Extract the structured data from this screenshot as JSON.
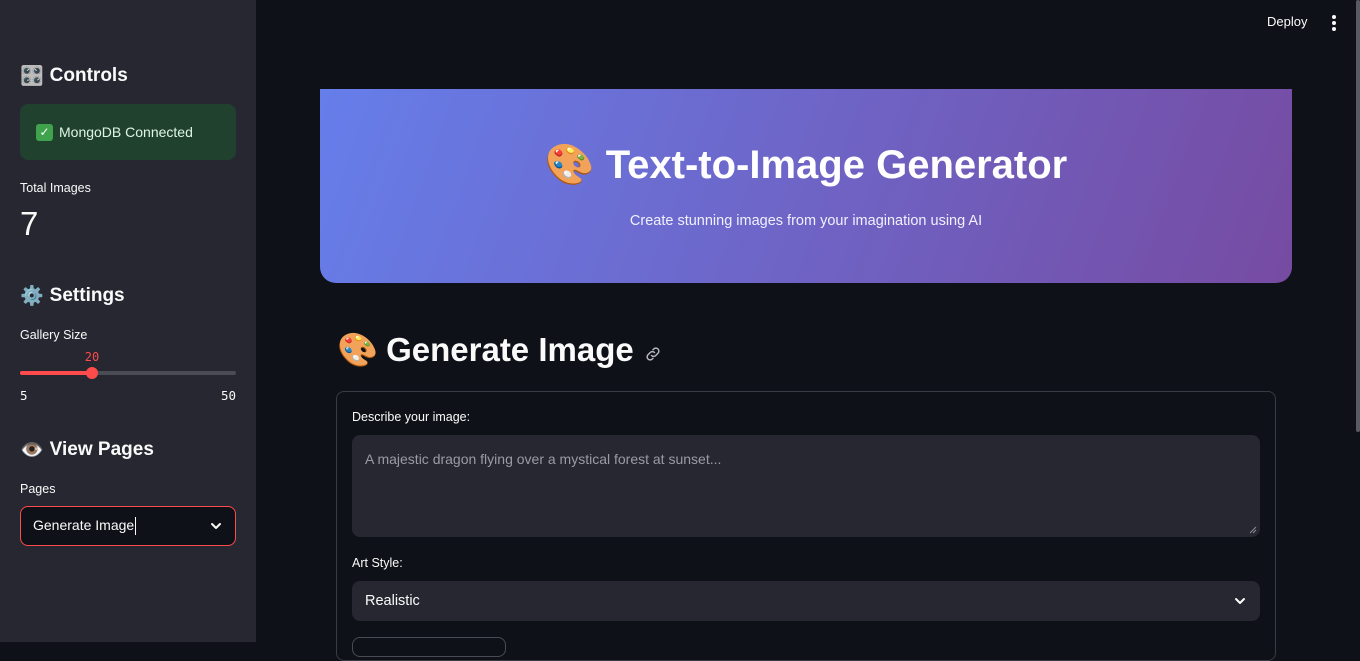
{
  "header": {
    "deploy_label": "Deploy"
  },
  "sidebar": {
    "controls_heading": {
      "icon": "🎛️",
      "text": "Controls"
    },
    "status": {
      "check": "✓",
      "text": "MongoDB Connected"
    },
    "total_images": {
      "label": "Total Images",
      "value": "7"
    },
    "settings_heading": {
      "icon": "⚙️",
      "text": "Settings"
    },
    "gallery_size": {
      "label": "Gallery Size",
      "value": 20,
      "min": 5,
      "max": 50,
      "value_text": "20",
      "min_text": "5",
      "max_text": "50"
    },
    "view_pages_heading": {
      "icon": "👁️",
      "text": "View Pages"
    },
    "pages": {
      "label": "Pages",
      "selected": "Generate Image"
    }
  },
  "hero": {
    "icon": "🎨",
    "title": "Text-to-Image Generator",
    "subtitle": "Create stunning images from your imagination using AI"
  },
  "main": {
    "section": {
      "icon": "🎨",
      "title": "Generate Image"
    },
    "prompt": {
      "label": "Describe your image:",
      "placeholder": "A majestic dragon flying over a mystical forest at sunset..."
    },
    "art_style": {
      "label": "Art Style:",
      "selected": "Realistic"
    }
  },
  "colors": {
    "accent": "#ff4b4b",
    "hero_start": "#667eea",
    "hero_end": "#764ba2",
    "sidebar_bg": "#262730",
    "page_bg": "#0e1117"
  }
}
